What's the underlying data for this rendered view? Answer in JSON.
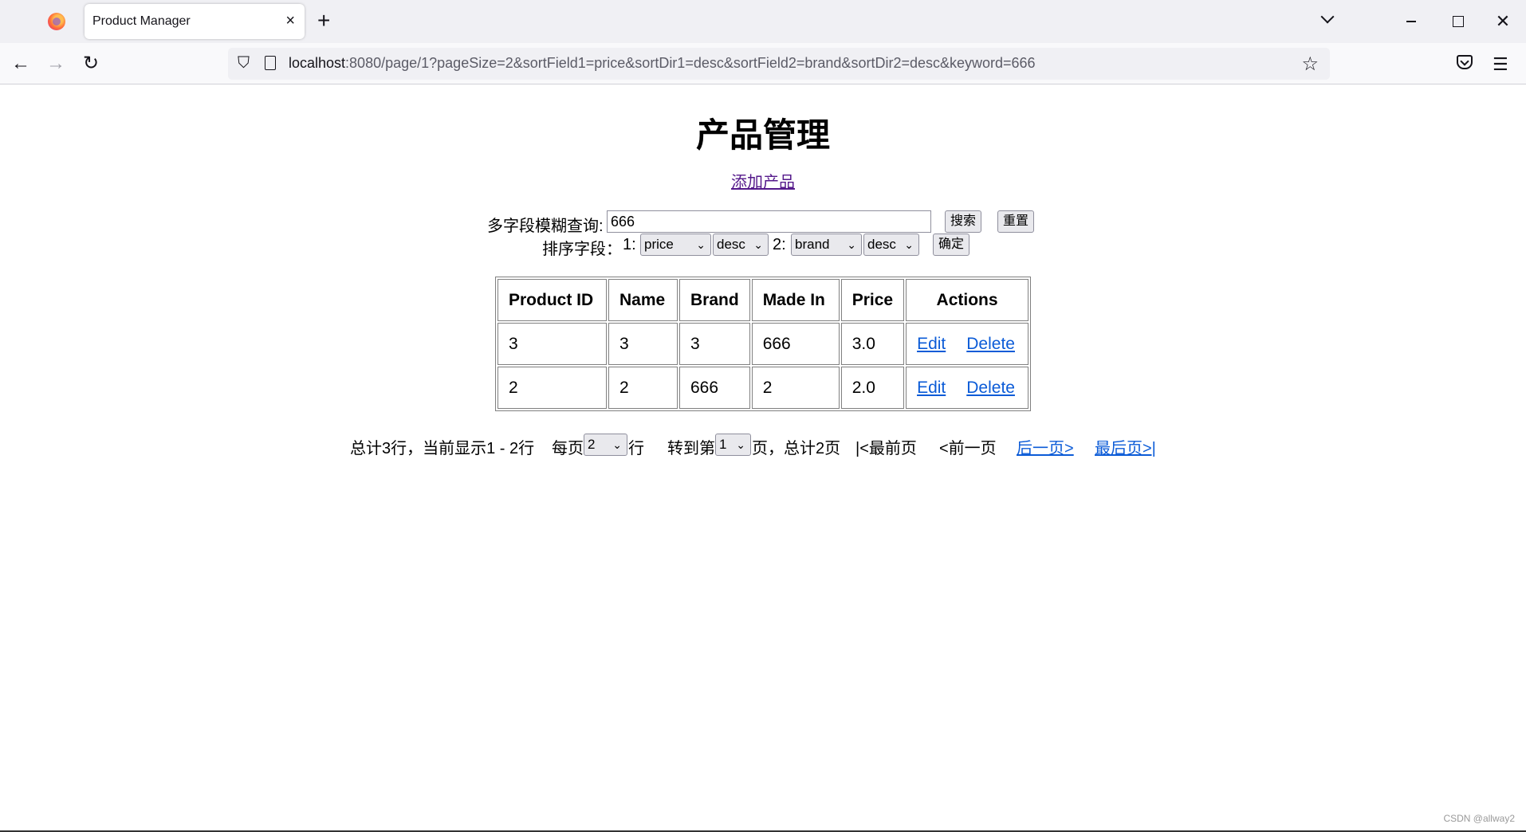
{
  "browser": {
    "tab_title": "Product Manager",
    "tab_close": "×",
    "new_tab": "+",
    "url_host": "localhost",
    "url_rest": ":8080/page/1?pageSize=2&sortField1=price&sortDir1=desc&sortField2=brand&sortDir2=desc&keyword=666",
    "icons": {
      "back": "arrow-left-icon",
      "forward": "arrow-right-icon",
      "reload": "reload-icon",
      "shield": "shield-icon",
      "bookmark": "star-icon",
      "pocket": "pocket-icon",
      "menu": "hamburger-menu-icon"
    }
  },
  "page": {
    "title": "产品管理",
    "add_link": "添加产品"
  },
  "search": {
    "label": "多字段模糊查询:",
    "value": "666",
    "search_button": "搜索",
    "reset_button": "重置"
  },
  "sort": {
    "label": "排序字段：",
    "field1_label": "1:",
    "field1": "price",
    "dir1": "desc",
    "field2_label": "2:",
    "field2": "brand",
    "dir2": "desc",
    "confirm_button": "确定"
  },
  "table": {
    "headers": [
      "Product ID",
      "Name",
      "Brand",
      "Made In",
      "Price",
      "Actions"
    ],
    "rows": [
      {
        "id": "3",
        "name": "3",
        "brand": "3",
        "made_in": "666",
        "price": "3.0",
        "edit": "Edit",
        "delete": "Delete"
      },
      {
        "id": "2",
        "name": "2",
        "brand": "666",
        "made_in": "2",
        "price": "2.0",
        "edit": "Edit",
        "delete": "Delete"
      }
    ]
  },
  "pager": {
    "summary": "总计3行，当前显示1 - 2行",
    "per_page_prefix": "每页",
    "per_page_value": "2",
    "per_page_suffix": "行",
    "goto_prefix": "转到第",
    "goto_value": "1",
    "goto_suffix": "页，总计2页",
    "first": "|<最前页",
    "prev": "<前一页",
    "next": "后一页>",
    "last": "最后页>|"
  },
  "watermark": "CSDN @allway2"
}
